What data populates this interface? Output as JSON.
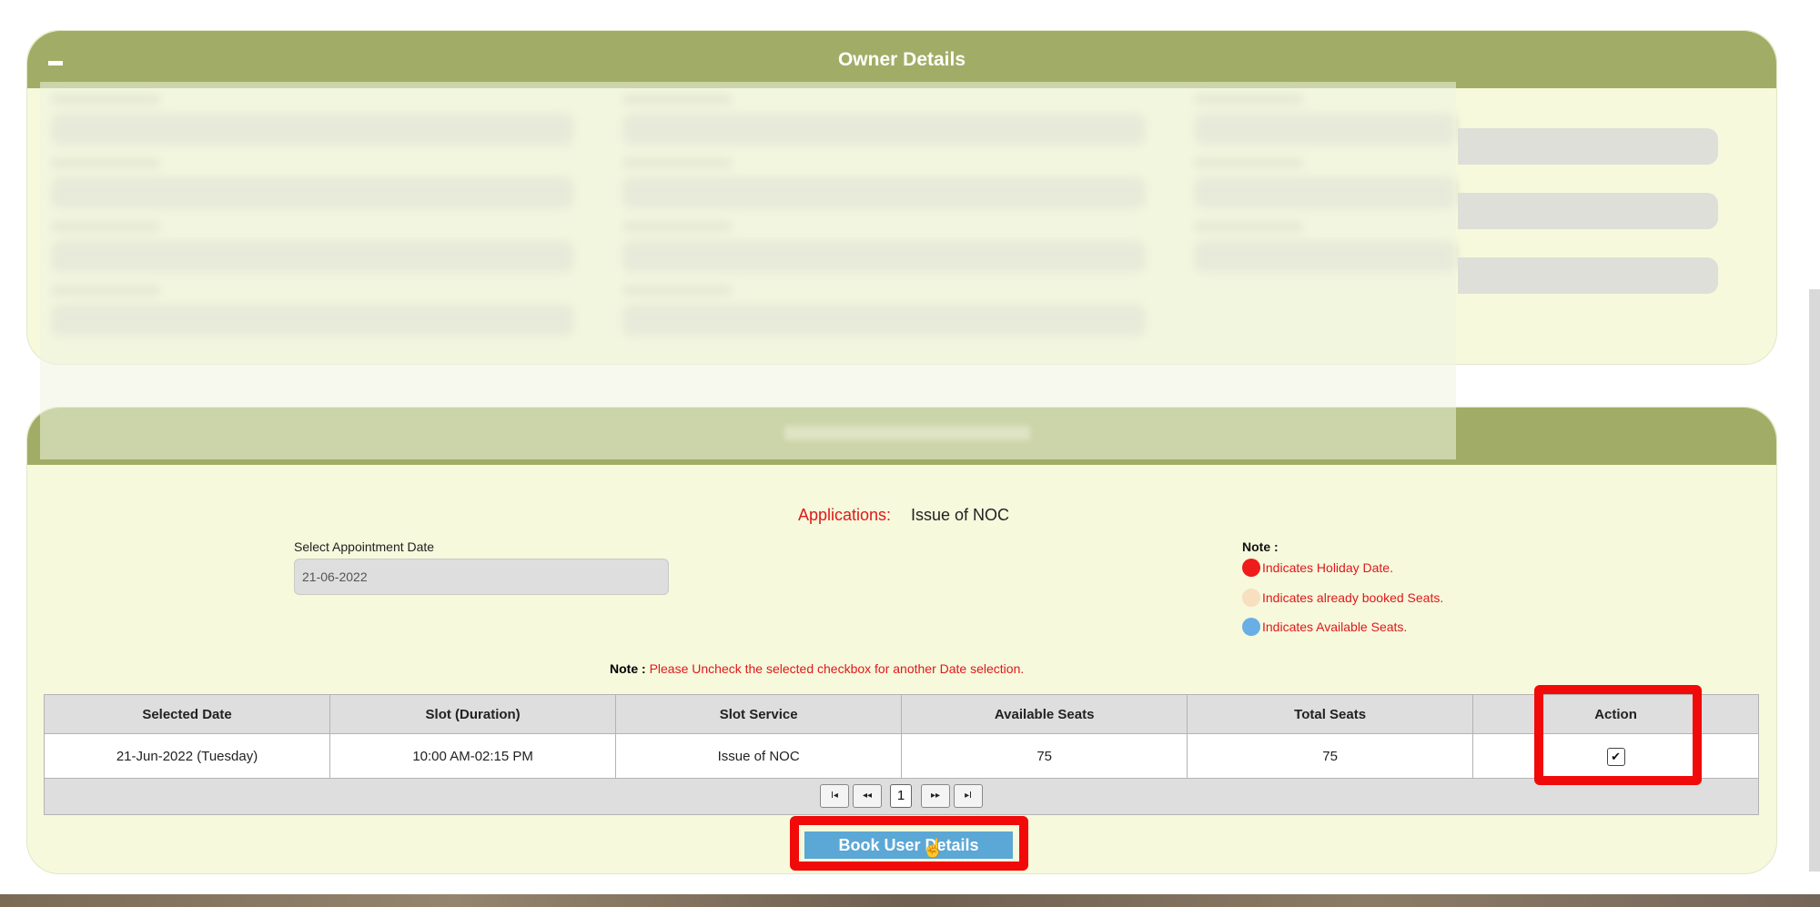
{
  "owner_panel": {
    "title": "Owner Details"
  },
  "appointment": {
    "applications_label": "Applications:",
    "applications_value": "Issue of NOC",
    "date_label": "Select Appointment Date",
    "date_value": "21-06-2022",
    "legend_title": "Note :",
    "legend": [
      {
        "text": "Indicates Holiday Date.",
        "color": "#ee1c1c"
      },
      {
        "text": "Indicates already booked Seats.",
        "color": "#f7dfbf"
      },
      {
        "text": "Indicates Available Seats.",
        "color": "#6aaee6"
      }
    ],
    "uncheck_note_prefix": "Note :",
    "uncheck_note_text": "Please Uncheck the selected checkbox for another Date selection."
  },
  "table": {
    "headers": [
      "Selected Date",
      "Slot (Duration)",
      "Slot Service",
      "Available Seats",
      "Total Seats",
      "Action"
    ],
    "rows": [
      {
        "date": "21-Jun-2022 (Tuesday)",
        "duration": "10:00 AM-02:15 PM",
        "service": "Issue of NOC",
        "available": "75",
        "total": "75",
        "action_checked": true
      }
    ]
  },
  "pager": {
    "first": "I◂",
    "prev": "◂◂",
    "current": "1",
    "next": "▸▸",
    "last": "▸I"
  },
  "book_button": {
    "label": "Book User Details"
  },
  "colors": {
    "header": "#a1ad66",
    "panel": "#f6f9dc",
    "highlight": "#f10a0a",
    "button": "#5ba7d6"
  }
}
